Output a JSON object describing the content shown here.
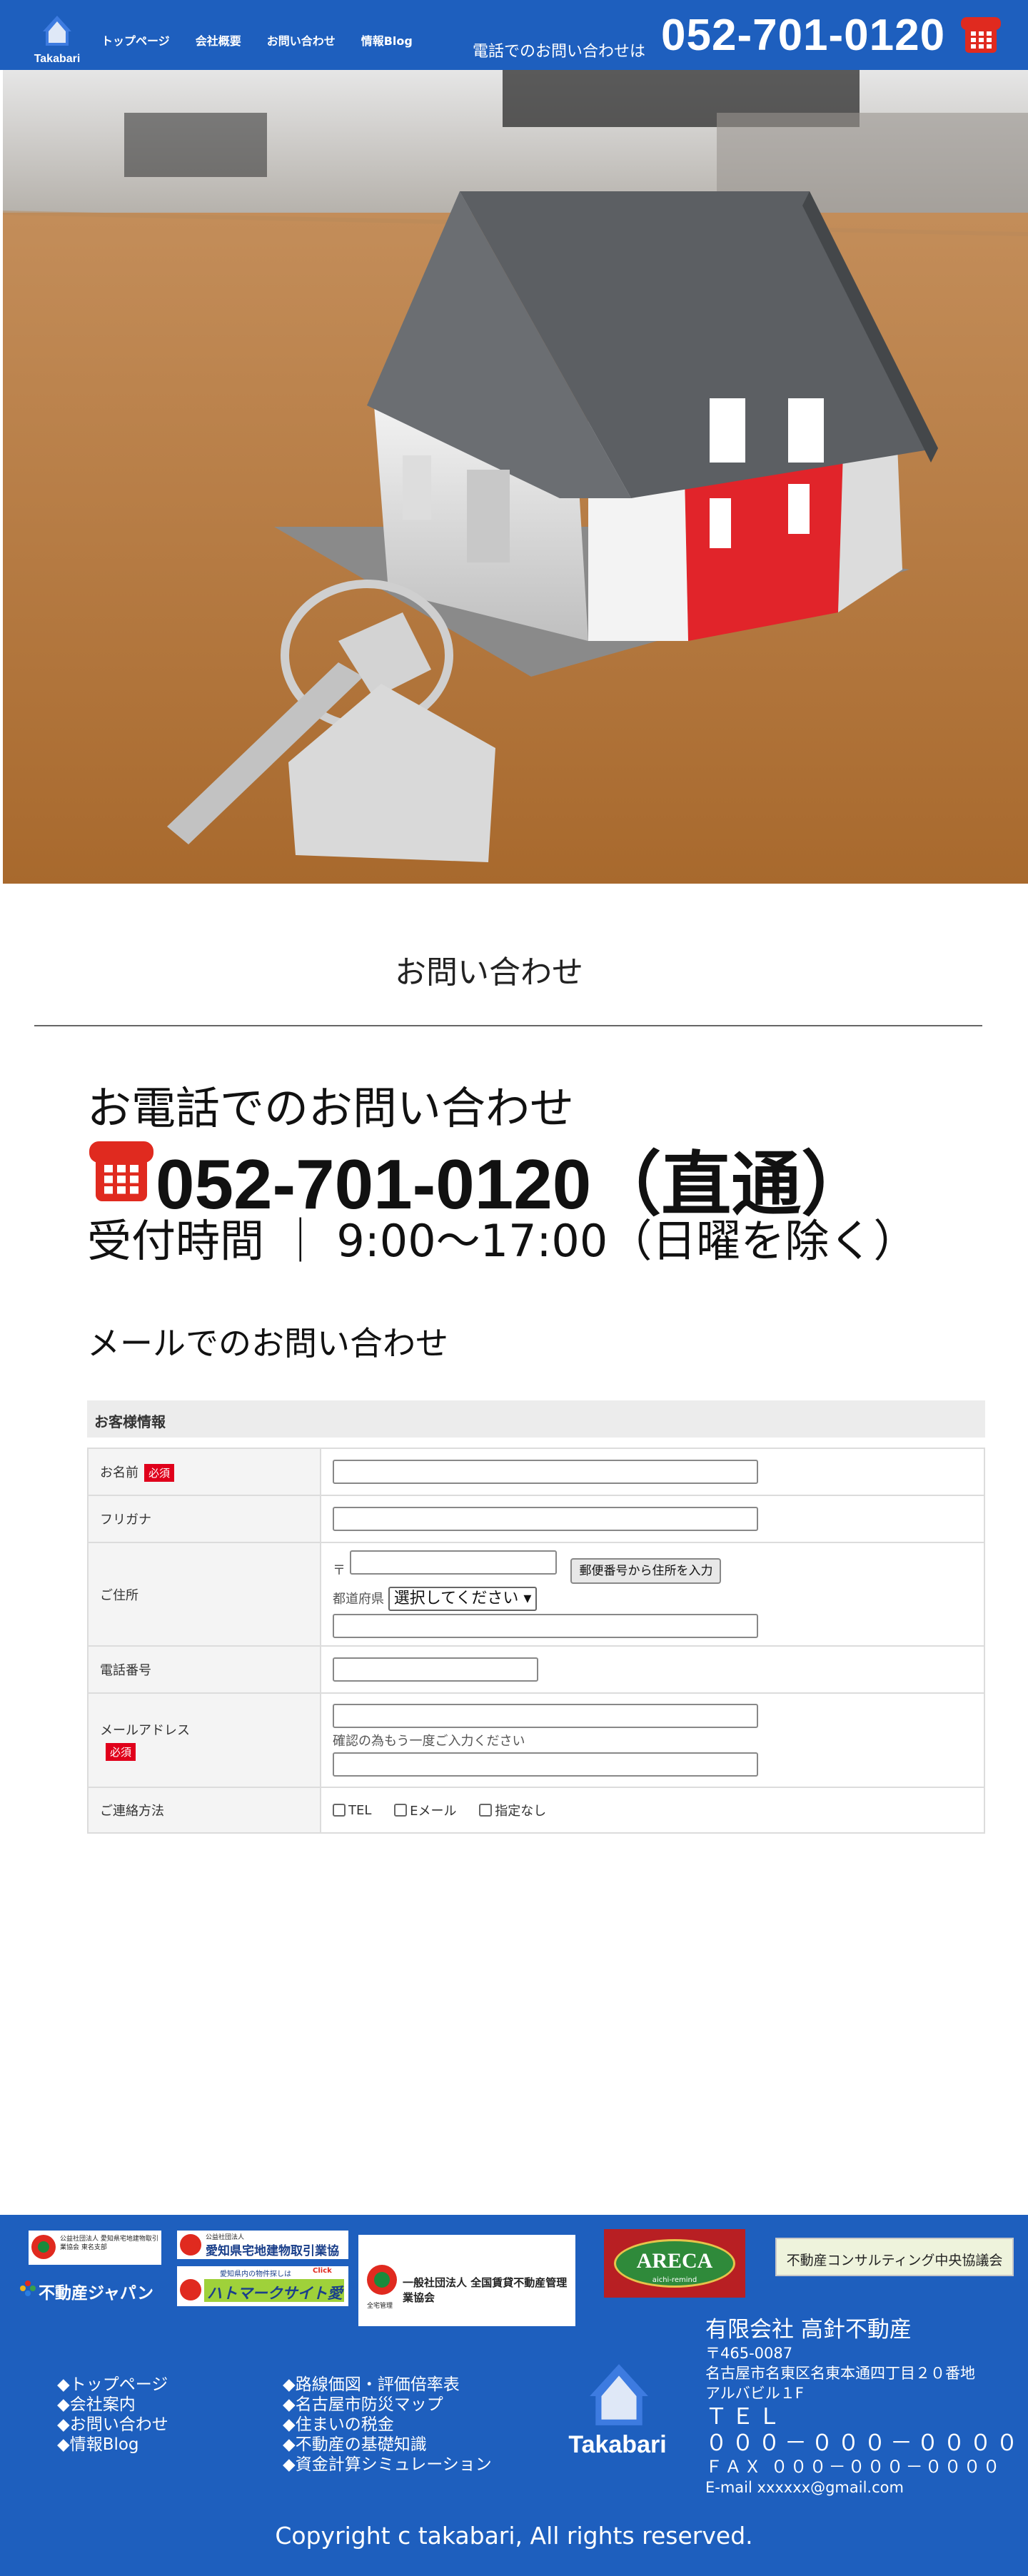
{
  "header": {
    "logo_text": "Takabari",
    "nav": [
      "トップページ",
      "会社概要",
      "お問い合わせ",
      "情報Blog"
    ],
    "tel_label": "電話でのお問い合わせは",
    "tel_number": "052-701-0120"
  },
  "main": {
    "section_title": "お問い合わせ",
    "tel_heading": "お電話でのお問い合わせ",
    "tel_big": "052-701-0120（直通）",
    "hours": "受付時間 ｜ 9:00〜17:00（日曜を除く）",
    "mail_heading": "メールでのお問い合わせ"
  },
  "form": {
    "section_label": "お客様情報",
    "required_badge": "必須",
    "name_label": "お名前",
    "furigana_label": "フリガナ",
    "address_label": "ご住所",
    "zip_mark": "〒",
    "zip_button": "郵便番号から住所を入力",
    "pref_label": "都道府県",
    "pref_selected": "選択してください",
    "phone_label": "電話番号",
    "email_label": "メールアドレス",
    "email_confirm_note": "確認の為もう一度ご入力ください",
    "contact_label": "ご連絡方法",
    "contact_options": [
      "TEL",
      "Eメール",
      "指定なし"
    ]
  },
  "footer": {
    "banners": {
      "b1": "公益社団法人 愛知県宅地建物取引業協会 東名支部",
      "b2_small": "公益社団法人",
      "b2": "愛知県宅地建物取引業協会",
      "b3": "一般社団法人 全国賃貸不動産管理業協会",
      "b3_small": "全宅管理",
      "b4": "ARECA",
      "b4_small": "aichi-remind",
      "b5": "不動産コンサルティング中央協議会",
      "b6": "不動産ジャパン",
      "b7_small": "愛知県内の物件探しは",
      "b7_click": "Click",
      "b7": "ハトマークサイト愛知"
    },
    "links_col1": [
      "◆トップページ",
      "◆会社案内",
      "◆お問い合わせ",
      "◆情報Blog"
    ],
    "links_col2": [
      "◆路線価図・評価倍率表",
      "◆名古屋市防災マップ",
      "◆住まいの税金",
      "◆不動産の基礎知識",
      "◆資金計算シミュレーション"
    ],
    "logo_text": "Takabari",
    "company_name": "有限会社 高針不動産",
    "postal": "〒465-0087",
    "address1": "名古屋市名東区名東本通四丁目２０番地",
    "address2": "アルバビル１F",
    "tel_label": "ＴＥＬ",
    "tel": "０００－０００－００００",
    "fax": "ＦＡＸ ０００－０００－００００",
    "email": "E-mail xxxxxx@gmail.com",
    "copyright": "Copyright c takabari, All rights reserved."
  }
}
